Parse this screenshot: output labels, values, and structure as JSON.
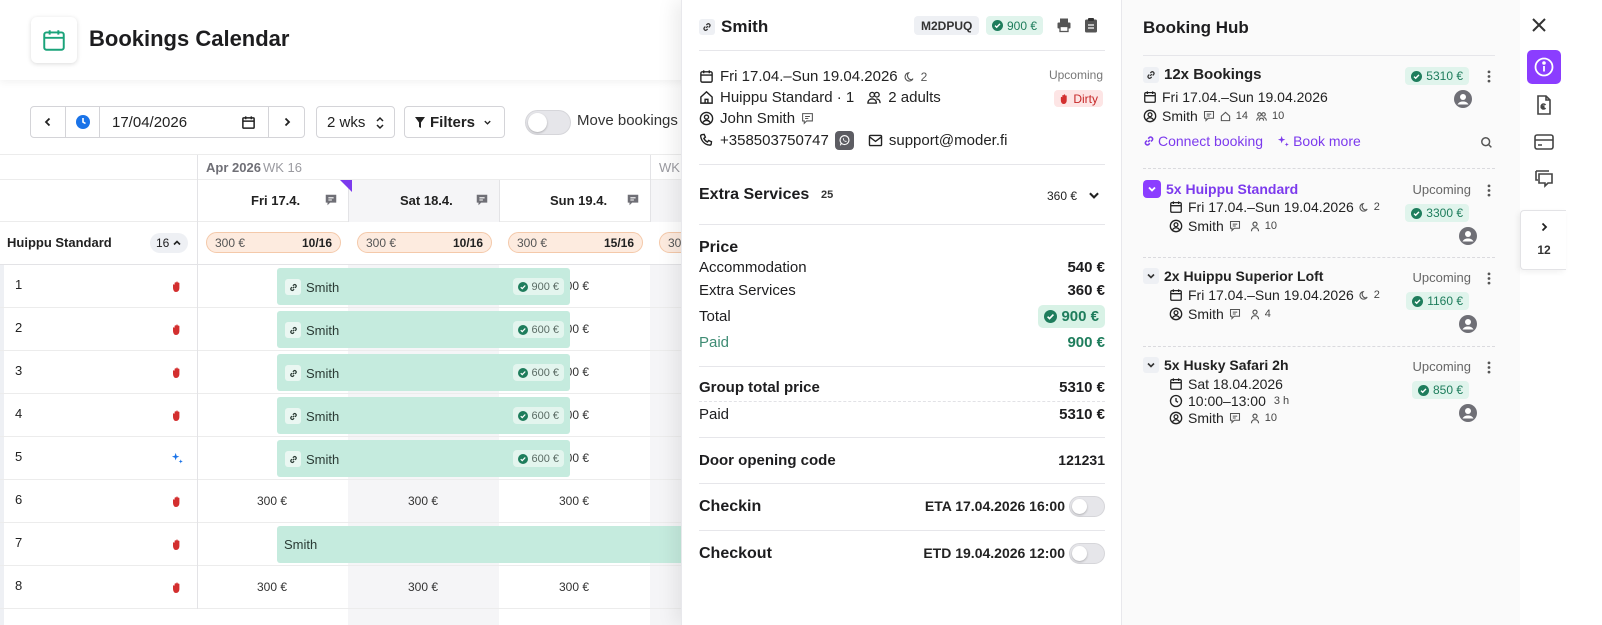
{
  "calendar": {
    "title": "Bookings Calendar",
    "toolbar": {
      "date_value": "17/04/2026",
      "range_label": "2 wks",
      "filters_label": "Filters",
      "move_bookings_label": "Move bookings"
    },
    "month_label": "Apr 2026",
    "week_labels": [
      "WK 16",
      "WK"
    ],
    "days": [
      "Fri 17.4.",
      "Sat 18.4.",
      "Sun 19.4."
    ],
    "room_type": {
      "name": "Huippu Standard",
      "count": "16",
      "availability": [
        {
          "price": "300 €",
          "count": "10/16"
        },
        {
          "price": "300 €",
          "count": "10/16"
        },
        {
          "price": "300 €",
          "count": "15/16"
        },
        {
          "price": "30",
          "count": ""
        }
      ]
    },
    "rows": [
      {
        "num": "1",
        "state": "dirty",
        "booking": {
          "name": "Smith",
          "price": "900 €",
          "linked": true
        },
        "cells": [
          "",
          "",
          "300 €"
        ]
      },
      {
        "num": "2",
        "state": "dirty",
        "booking": {
          "name": "Smith",
          "price": "600 €",
          "linked": true
        },
        "cells": [
          "",
          "",
          "300 €"
        ]
      },
      {
        "num": "3",
        "state": "dirty",
        "booking": {
          "name": "Smith",
          "price": "600 €",
          "linked": true
        },
        "cells": [
          "",
          "",
          "300 €"
        ]
      },
      {
        "num": "4",
        "state": "dirty",
        "booking": {
          "name": "Smith",
          "price": "600 €",
          "linked": true
        },
        "cells": [
          "",
          "",
          "300 €"
        ]
      },
      {
        "num": "5",
        "state": "clean",
        "booking": {
          "name": "Smith",
          "price": "600 €",
          "linked": true
        },
        "cells": [
          "",
          "",
          "300 €"
        ]
      },
      {
        "num": "6",
        "state": "dirty",
        "booking": null,
        "cells": [
          "300 €",
          "300 €",
          "300 €"
        ]
      },
      {
        "num": "7",
        "state": "dirty",
        "booking": {
          "name": "Smith",
          "price": "",
          "linked": false
        },
        "cells": [
          "",
          "",
          ""
        ]
      },
      {
        "num": "8",
        "state": "dirty",
        "booking": null,
        "cells": [
          "300 €",
          "300 €",
          "300 €"
        ]
      }
    ]
  },
  "detail": {
    "guest_name": "Smith",
    "booking_code": "M2DPUQ",
    "price_chip": "900 €",
    "dates": "Fri 17.04.–Sun 19.04.2026",
    "nights": "2",
    "status": "Upcoming",
    "room": "Huippu Standard · 1",
    "guests": "2 adults",
    "cleaning": "Dirty",
    "contact_name": "John Smith",
    "phone": "+358503750747",
    "email": "support@moder.fi",
    "extra_services": {
      "title": "Extra Services",
      "count": "25",
      "total": "360 €"
    },
    "price": {
      "heading": "Price",
      "accommodation_label": "Accommodation",
      "accommodation": "540 €",
      "extras_label": "Extra Services",
      "extras": "360 €",
      "total_label": "Total",
      "total": "900 €",
      "paid_label": "Paid",
      "paid": "900 €"
    },
    "group": {
      "total_label": "Group total price",
      "total": "5310 €",
      "paid_label": "Paid",
      "paid": "5310 €"
    },
    "door": {
      "label": "Door opening code",
      "code": "121231"
    },
    "checkin": {
      "label": "Checkin",
      "eta": "ETA 17.04.2026 16:00"
    },
    "checkout": {
      "label": "Checkout",
      "etd": "ETD 19.04.2026 12:00"
    }
  },
  "hub": {
    "title": "Booking Hub",
    "group": {
      "title": "12x Bookings",
      "price": "5310 €",
      "dates": "Fri 17.04.–Sun 19.04.2026",
      "guest": "Smith",
      "rooms": "14",
      "people": "10",
      "connect_label": "Connect booking",
      "book_more_label": "Book more"
    },
    "items": [
      {
        "title": "5x Huippu Standard",
        "status": "Upcoming",
        "dates": "Fri 17.04.–Sun 19.04.2026",
        "nights": "2",
        "guest": "Smith",
        "people": "10",
        "price": "3300 €",
        "selected": true
      },
      {
        "title": "2x Huippu Superior Loft",
        "status": "Upcoming",
        "dates": "Fri 17.04.–Sun 19.04.2026",
        "nights": "2",
        "guest": "Smith",
        "people": "4",
        "price": "1160 €",
        "selected": false
      },
      {
        "title": "5x Husky Safari 2h",
        "status": "Upcoming",
        "dates": "Sat 18.04.2026",
        "time": "10:00–13:00",
        "duration": "3 h",
        "guest": "Smith",
        "people": "10",
        "price": "850 €",
        "selected": false
      }
    ]
  },
  "rail": {
    "icons": [
      "info-icon",
      "invoice-icon",
      "payment-card-icon",
      "messages-icon"
    ],
    "collapsed_count": "12"
  },
  "colors": {
    "accent": "#8b3dff",
    "booking_bar": "#c5ebde",
    "paid_green": "#1e7d5c",
    "dirty_red": "#d32f2f",
    "availability": "#fdebdf"
  }
}
